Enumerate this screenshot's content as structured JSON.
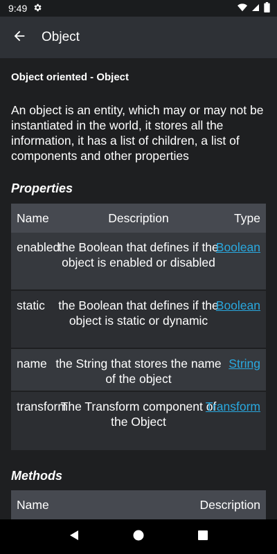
{
  "status_bar": {
    "time": "9:49"
  },
  "app_bar": {
    "title": "Object"
  },
  "page": {
    "heading": "Object oriented - Object",
    "intro": "An object is an entity, which may or may not be instantiated in the world, it stores all the information, it has a list of children, a list of components and other properties"
  },
  "properties": {
    "title": "Properties",
    "headers": {
      "name": "Name",
      "description": "Description",
      "type": "Type"
    },
    "rows": [
      {
        "name": "enabled",
        "description": "the Boolean that defines if the object is enabled or disabled",
        "type": "Boolean"
      },
      {
        "name": "static",
        "description": "the Boolean that defines if the object is static or dynamic",
        "type": "Boolean"
      },
      {
        "name": "name",
        "description": "the String that stores the name of the object",
        "type": "String"
      },
      {
        "name": "transform",
        "description": "The Transform component of the Object",
        "type": "Transform"
      }
    ]
  },
  "methods": {
    "title": "Methods",
    "headers": {
      "name": "Name",
      "description": "Description"
    }
  },
  "icons": {
    "settings": "gear-icon",
    "wifi": "wifi-icon",
    "signal": "cell-signal-icon",
    "battery": "battery-icon",
    "back": "arrow-left-icon",
    "nav_back": "triangle-back-icon",
    "nav_home": "circle-home-icon",
    "nav_recents": "square-recents-icon"
  },
  "colors": {
    "link": "#29a9e0",
    "app_bar": "#2e3136",
    "table_header": "#464950"
  }
}
